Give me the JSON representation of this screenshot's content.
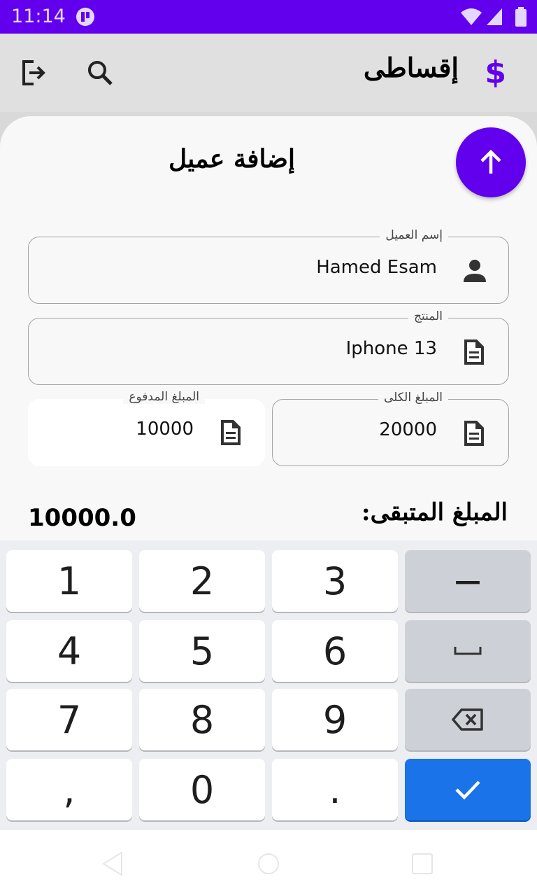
{
  "status_bar": {
    "time": "11:14"
  },
  "app_bar": {
    "title": "إقساطى",
    "brand_icon": "$",
    "accent_color": "#6200ee"
  },
  "sheet": {
    "title": "إضافة عميل"
  },
  "fields": {
    "customer_name": {
      "label": "إسم العميل",
      "value": "Hamed Esam",
      "icon": "person-icon"
    },
    "product": {
      "label": "المنتج",
      "value": "Iphone 13",
      "icon": "document-icon"
    },
    "total_amount": {
      "label": "المبلغ الكلى",
      "value": "20000",
      "icon": "document-icon"
    },
    "paid_amount": {
      "label": "المبلغ المدفوع",
      "value": "10000",
      "icon": "document-icon"
    }
  },
  "remaining": {
    "label": "المبلغ المتبقى:",
    "value": "10000.0"
  },
  "keyboard": {
    "k1": "1",
    "k2": "2",
    "k3": "3",
    "minus": "−",
    "k4": "4",
    "k5": "5",
    "k6": "6",
    "k7": "7",
    "k8": "8",
    "k9": "9",
    "comma": ",",
    "k0": "0",
    "period": ".",
    "confirm_color": "#1a73e8"
  }
}
